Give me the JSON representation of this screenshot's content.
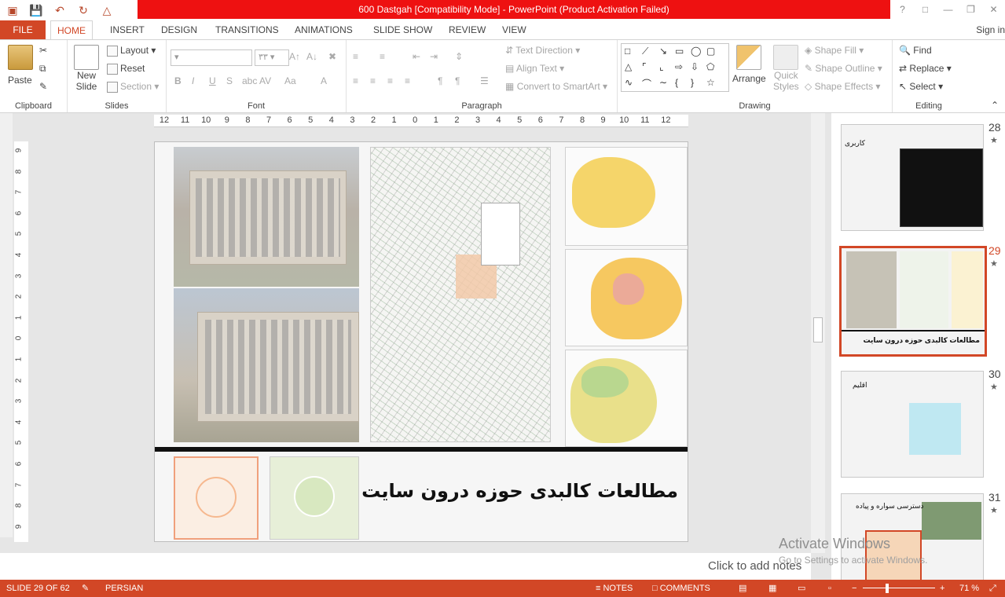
{
  "window": {
    "title": "600 Dastgah [Compatibility Mode] -  PowerPoint (Product Activation Failed)",
    "controls": [
      "?",
      "❐",
      "—",
      "❐",
      "✕"
    ]
  },
  "qat": {
    "save": "save-icon",
    "undo": "undo-icon",
    "redo": "redo-icon",
    "present": "present-icon"
  },
  "tabs": {
    "file": "FILE",
    "items": [
      "HOME",
      "INSERT",
      "DESIGN",
      "TRANSITIONS",
      "ANIMATIONS",
      "SLIDE SHOW",
      "REVIEW",
      "VIEW"
    ],
    "signin": "Sign in"
  },
  "ribbon": {
    "clipboard": {
      "label": "Clipboard",
      "paste": "Paste"
    },
    "slides": {
      "label": "Slides",
      "new_slide": "New",
      "new_slide2": "Slide",
      "layout": "Layout",
      "reset": "Reset",
      "section": "Section"
    },
    "font": {
      "label": "Font",
      "size": "۳۳"
    },
    "paragraph": {
      "label": "Paragraph",
      "text_direction": "Text Direction",
      "align_text": "Align Text",
      "convert_smartart": "Convert to SmartArt"
    },
    "drawing": {
      "label": "Drawing",
      "arrange": "Arrange",
      "quick_styles": "Quick",
      "quick_styles2": "Styles",
      "shape_fill": "Shape Fill",
      "shape_outline": "Shape Outline",
      "shape_effects": "Shape Effects"
    },
    "editing": {
      "label": "Editing",
      "find": "Find",
      "replace": "Replace",
      "select": "Select"
    }
  },
  "ruler": {
    "h": [
      "12",
      "11",
      "10",
      "9",
      "8",
      "7",
      "6",
      "5",
      "4",
      "3",
      "2",
      "1",
      "0",
      "1",
      "2",
      "3",
      "4",
      "5",
      "6",
      "7",
      "8",
      "9",
      "10",
      "11",
      "12"
    ],
    "v": [
      "9",
      "8",
      "7",
      "6",
      "5",
      "4",
      "3",
      "2",
      "1",
      "0",
      "1",
      "2",
      "3",
      "4",
      "5",
      "6",
      "7",
      "8",
      "9"
    ]
  },
  "slide": {
    "title": "مطالعات کالبدی حوزه درون سایت"
  },
  "thumbnails": [
    {
      "num": "28",
      "star": "★",
      "title": "کاربری"
    },
    {
      "num": "29",
      "star": "★",
      "title": "مطالعات کالبدی حوزه درون سایت"
    },
    {
      "num": "30",
      "star": "★",
      "title": "اقلیم"
    },
    {
      "num": "31",
      "star": "★",
      "title": "دسترسی سواره و پیاده"
    }
  ],
  "notes": {
    "placeholder": "Click to add notes"
  },
  "watermark": {
    "line1": "Activate Windows",
    "line2": "Go to Settings to activate Windows."
  },
  "status": {
    "slide": "SLIDE 29 OF 62",
    "language": "PERSIAN",
    "notes": "NOTES",
    "comments": "COMMENTS",
    "zoom": "71 %"
  }
}
